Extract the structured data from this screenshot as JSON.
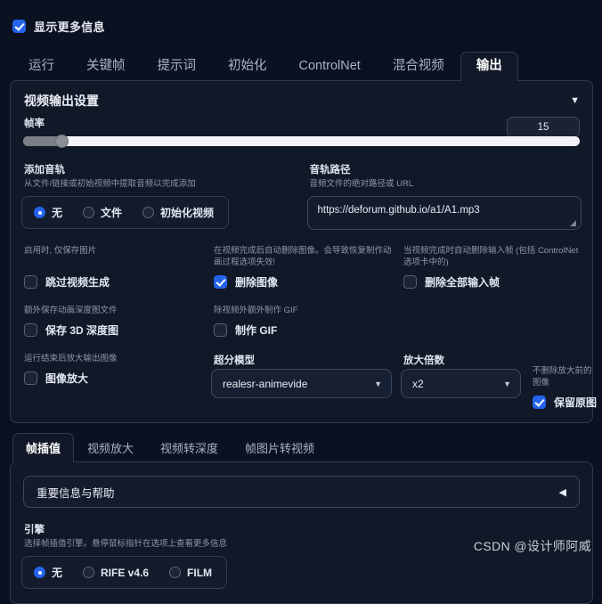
{
  "topbar": {
    "show_more_info_label": "显示更多信息",
    "show_more_info_checked": true
  },
  "main_tabs": [
    {
      "label": "运行",
      "active": false
    },
    {
      "label": "关键帧",
      "active": false
    },
    {
      "label": "提示词",
      "active": false
    },
    {
      "label": "初始化",
      "active": false
    },
    {
      "label": "ControlNet",
      "active": false
    },
    {
      "label": "混合视频",
      "active": false
    },
    {
      "label": "输出",
      "active": true
    }
  ],
  "video_output": {
    "title": "视频输出设置",
    "collapse_caret": "▼",
    "fps": {
      "label": "帧率",
      "value": "15",
      "fill_percent": 7
    },
    "add_soundtrack": {
      "label": "添加音轨",
      "hint": "从文件/链接或初始视频中提取音频以完成添加",
      "options": [
        {
          "label": "无",
          "selected": true
        },
        {
          "label": "文件",
          "selected": false
        },
        {
          "label": "初始化视频",
          "selected": false
        }
      ]
    },
    "soundtrack_path": {
      "label": "音轨路径",
      "hint": "音频文件的绝对路径或 URL",
      "value": "https://deforum.github.io/a1/A1.mp3"
    },
    "skip_video_creation": {
      "hint": "启用时, 仅保存图片",
      "label": "跳过视频生成",
      "checked": false
    },
    "delete_imgs": {
      "hint": "在视频完成后自动删除图像。会导致恢复制作动画过程选项失效!",
      "label": "删除图像",
      "checked": true
    },
    "delete_input_frames": {
      "hint": "当视频完成时自动删除输入帧 (包括 ControlNet 选项卡中的)",
      "label": "删除全部输入帧",
      "checked": false
    },
    "save_depth_maps": {
      "hint": "额外保存动画深度图文件",
      "label": "保存 3D 深度图",
      "checked": false
    },
    "make_gif": {
      "hint": "除视频外额外制作 GIF",
      "label": "制作 GIF",
      "checked": false
    },
    "image_upscale": {
      "hint": "运行结束后放大输出图像",
      "label": "图像放大",
      "checked": false
    },
    "upscale_model": {
      "label": "超分模型",
      "value": "realesr-animevide",
      "caret": "▼"
    },
    "upscale_factor": {
      "label": "放大倍数",
      "value": "x2",
      "caret": "▼"
    },
    "keep_original": {
      "hint": "不删除放大前的图像",
      "label": "保留原图",
      "checked": true
    }
  },
  "bottom_tabs": [
    {
      "label": "帧插值",
      "active": true
    },
    {
      "label": "视频放大",
      "active": false
    },
    {
      "label": "视频转深度",
      "active": false
    },
    {
      "label": "帧图片转视频",
      "active": false
    }
  ],
  "help_accordion": {
    "title": "重要信息与帮助",
    "caret": "◀"
  },
  "engine": {
    "label": "引擎",
    "hint": "选择帧插值引擎。悬停鼠标指针在选项上查看更多信息",
    "options": [
      {
        "label": "无",
        "selected": true
      },
      {
        "label": "RIFE v4.6",
        "selected": false
      },
      {
        "label": "FILM",
        "selected": false
      }
    ]
  },
  "watermark": "CSDN @设计师阿威",
  "colors": {
    "accent": "#2563eb",
    "page_bg": "#0b1120",
    "panel_bg": "#111827",
    "border": "#303a50"
  }
}
